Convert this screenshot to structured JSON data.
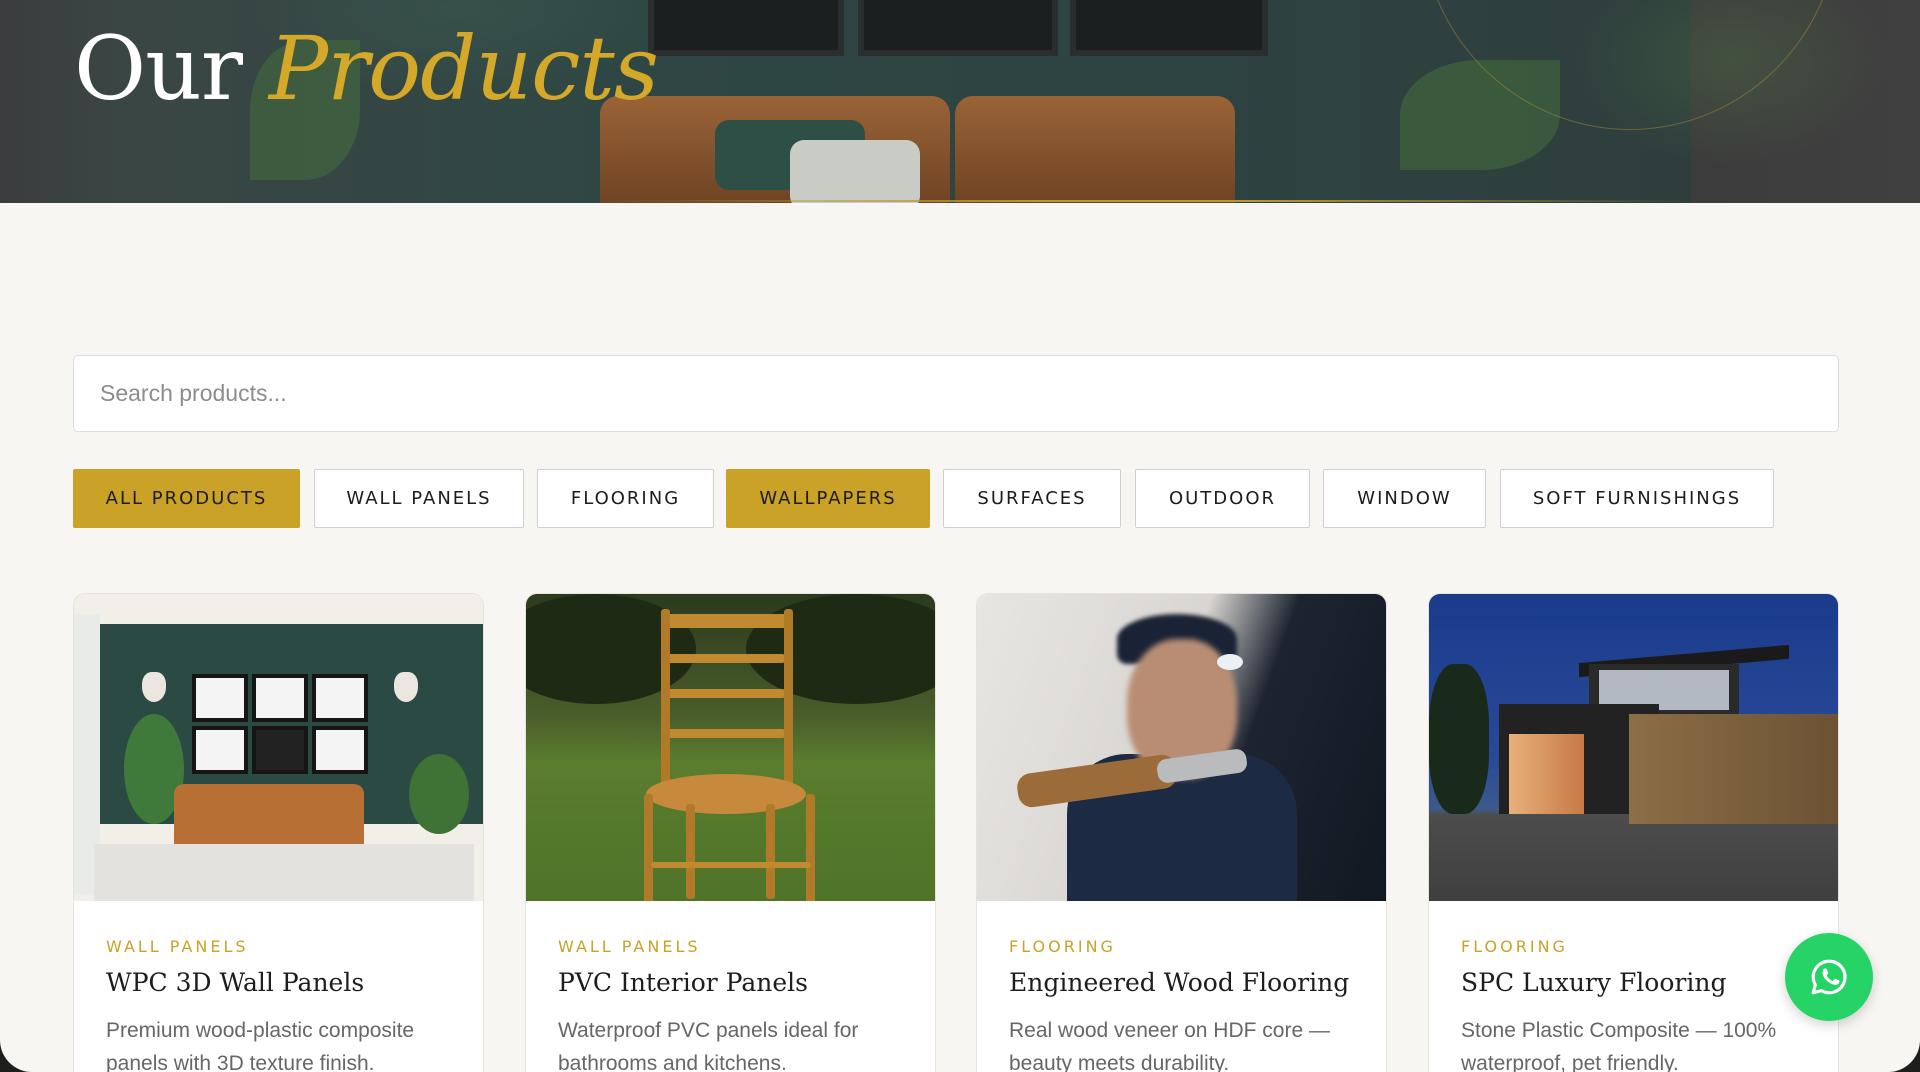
{
  "hero": {
    "title_plain": "Our",
    "title_accent": "Products"
  },
  "search": {
    "placeholder": "Search products..."
  },
  "filters": [
    {
      "label": "ALL PRODUCTS",
      "active": true
    },
    {
      "label": "WALL PANELS",
      "active": false
    },
    {
      "label": "FLOORING",
      "active": false
    },
    {
      "label": "WALLPAPERS",
      "active": true
    },
    {
      "label": "SURFACES",
      "active": false
    },
    {
      "label": "OUTDOOR",
      "active": false
    },
    {
      "label": "WINDOW",
      "active": false
    },
    {
      "label": "SOFT FURNISHINGS",
      "active": false
    }
  ],
  "products": [
    {
      "category": "WALL PANELS",
      "title": "WPC 3D Wall Panels",
      "description": "Premium wood-plastic composite panels with 3D texture finish."
    },
    {
      "category": "WALL PANELS",
      "title": "PVC Interior Panels",
      "description": "Waterproof PVC panels ideal for bathrooms and kitchens."
    },
    {
      "category": "FLOORING",
      "title": "Engineered Wood Flooring",
      "description": "Real wood veneer on HDF core — beauty meets durability."
    },
    {
      "category": "FLOORING",
      "title": "SPC Luxury Flooring",
      "description": "Stone Plastic Composite — 100% waterproof, pet friendly."
    }
  ],
  "colors": {
    "accent": "#c9a227",
    "background": "#f8f6f3",
    "whatsapp": "#25d366"
  },
  "icons": {
    "chat_button": "whatsapp-icon"
  }
}
